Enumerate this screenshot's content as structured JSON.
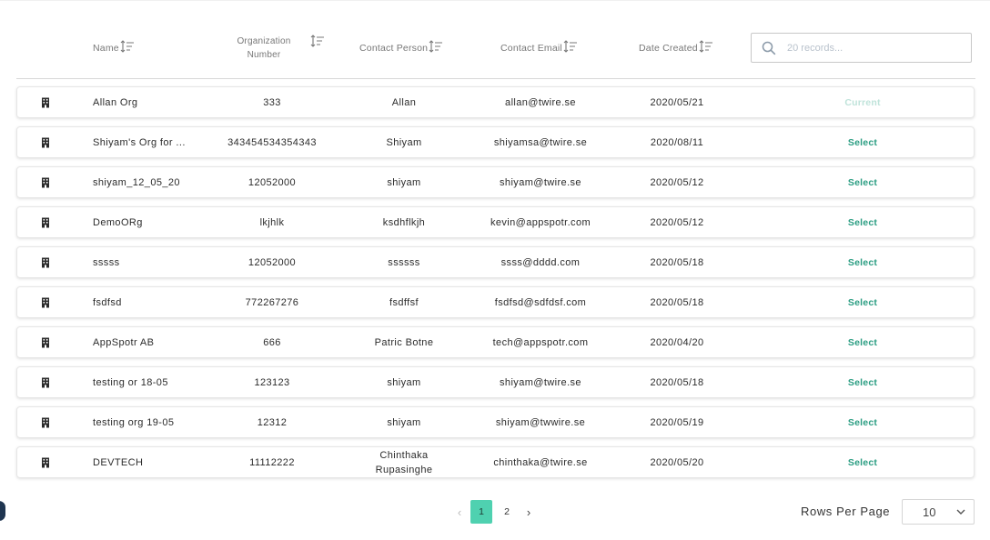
{
  "header": {
    "name": "Name",
    "org_number": "Organization Number",
    "contact_person": "Contact Person",
    "contact_email": "Contact Email",
    "date_created": "Date Created"
  },
  "search": {
    "placeholder": "20 records..."
  },
  "rows": [
    {
      "name": "Allan Org",
      "org": "333",
      "contact": "Allan",
      "email": "allan@twire.se",
      "date": "2020/05/21",
      "action": "Current"
    },
    {
      "name": "Shiyam's Org for ...",
      "org": "343454534354343",
      "contact": "Shiyam",
      "email": "shiyamsa@twire.se",
      "date": "2020/08/11",
      "action": "Select"
    },
    {
      "name": "shiyam_12_05_20",
      "org": "12052000",
      "contact": "shiyam",
      "email": "shiyam@twire.se",
      "date": "2020/05/12",
      "action": "Select"
    },
    {
      "name": "DemoORg",
      "org": "lkjhlk",
      "contact": "ksdhflkjh",
      "email": "kevin@appspotr.com",
      "date": "2020/05/12",
      "action": "Select"
    },
    {
      "name": "sssss",
      "org": "12052000",
      "contact": "ssssss",
      "email": "ssss@dddd.com",
      "date": "2020/05/18",
      "action": "Select"
    },
    {
      "name": "fsdfsd",
      "org": "772267276",
      "contact": "fsdffsf",
      "email": "fsdfsd@sdfdsf.com",
      "date": "2020/05/18",
      "action": "Select"
    },
    {
      "name": "AppSpotr AB",
      "org": "666",
      "contact": "Patric Botne",
      "email": "tech@appspotr.com",
      "date": "2020/04/20",
      "action": "Select"
    },
    {
      "name": "testing or 18-05",
      "org": "123123",
      "contact": "shiyam",
      "email": "shiyam@twire.se",
      "date": "2020/05/18",
      "action": "Select"
    },
    {
      "name": "testing org 19-05",
      "org": "12312",
      "contact": "shiyam",
      "email": "shiyam@twwire.se",
      "date": "2020/05/19",
      "action": "Select"
    },
    {
      "name": "DEVTECH",
      "org": "11112222",
      "contact": "Chinthaka Rupasinghe",
      "email": "chinthaka@twire.se",
      "date": "2020/05/20",
      "action": "Select"
    }
  ],
  "pagination": {
    "prev_icon": "chevron-left-icon",
    "pages": [
      "1",
      "2"
    ],
    "current": "1",
    "next_icon": "chevron-right-icon"
  },
  "rows_per_page": {
    "label": "Rows Per Page",
    "value": "10"
  },
  "colors": {
    "accent": "#4fd1b0",
    "select_text": "#2a9d82",
    "current_text": "#bfe3da"
  },
  "icons": {
    "row_icon": "building-icon",
    "sort": "sort-icon",
    "search": "search-icon",
    "dropdown": "chevron-down-icon"
  }
}
